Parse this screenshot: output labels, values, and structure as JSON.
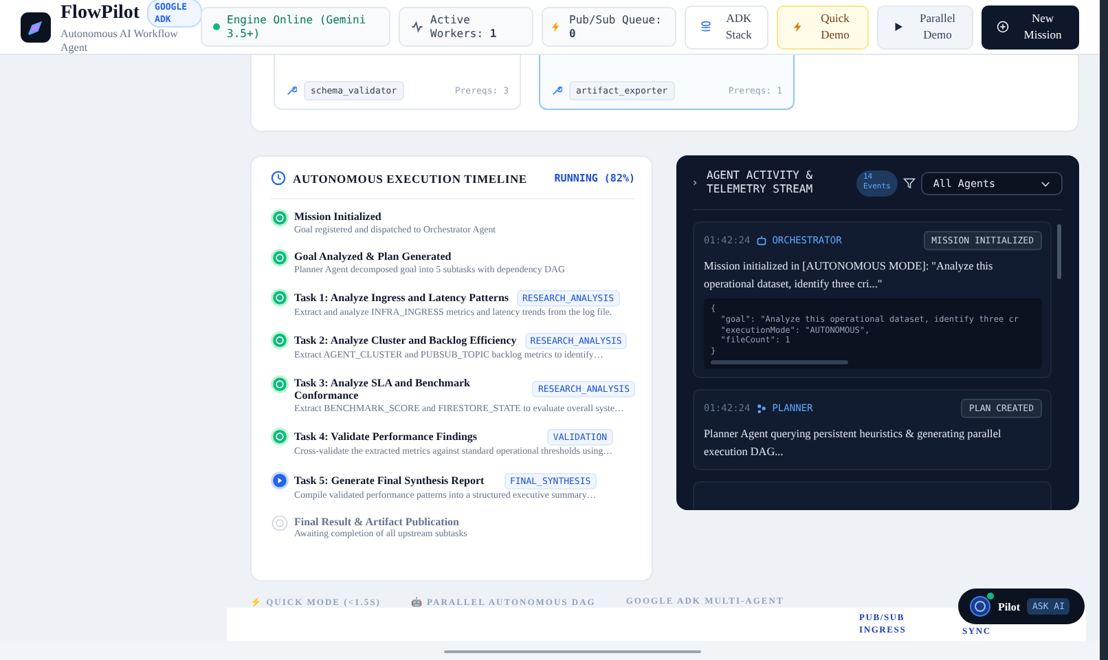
{
  "header": {
    "app_name": "FlowPilot",
    "badge": "GOOGLE ADK",
    "subtitle": "Autonomous AI Workflow Agent",
    "status_chips": [
      {
        "kind": "engine",
        "label": "Engine Online (Gemini 3.5+)"
      },
      {
        "kind": "workers",
        "label": "Active Workers:",
        "value": "1"
      },
      {
        "kind": "queue",
        "label": "Pub/Sub Queue:",
        "value": "0"
      }
    ],
    "buttons": [
      {
        "kind": "stack",
        "label": "ADK Stack"
      },
      {
        "kind": "quick",
        "label": "Quick Demo"
      },
      {
        "kind": "parallel",
        "label": "Parallel Demo"
      },
      {
        "kind": "new",
        "label": "New Mission"
      }
    ]
  },
  "tools": [
    {
      "name": "schema_validator",
      "prereqs": "Prereqs: 3",
      "selected": false
    },
    {
      "name": "artifact_exporter",
      "prereqs": "Prereqs: 1",
      "selected": true
    }
  ],
  "timeline": {
    "title": "AUTONOMOUS EXECUTION TIMELINE",
    "status": "RUNNING (82%)",
    "steps": [
      {
        "kind": "done",
        "title": "Mission Initialized",
        "desc": "Goal registered and dispatched to Orchestrator Agent"
      },
      {
        "kind": "done",
        "title": "Goal Analyzed & Plan Generated",
        "desc": "Planner Agent decomposed goal into 5 subtasks with dependency DAG"
      },
      {
        "kind": "done",
        "title": "Task 1: Analyze Ingress and Latency Patterns",
        "tag": "RESEARCH_ANALYSIS",
        "desc": "Extract and analyze INFRA_INGRESS metrics and latency trends from the log file."
      },
      {
        "kind": "done",
        "title": "Task 2: Analyze Cluster and Backlog Efficiency",
        "tag": "RESEARCH_ANALYSIS",
        "desc": "Extract AGENT_CLUSTER and PUBSUB_TOPIC backlog metrics to identify…"
      },
      {
        "kind": "done",
        "title": "Task 3: Analyze SLA and Benchmark Conformance",
        "tag": "RESEARCH_ANALYSIS",
        "desc": "Extract BENCHMARK_SCORE and FIRESTORE_STATE to evaluate overall syste…"
      },
      {
        "kind": "done",
        "title": "Task 4: Validate Performance Findings",
        "tag": "VALIDATION",
        "desc": "Cross-validate the extracted metrics against standard operational thresholds using…"
      },
      {
        "kind": "active",
        "title": "Task 5: Generate Final Synthesis Report",
        "tag": "FINAL_SYNTHESIS",
        "desc": "Compile validated performance patterns into a structured executive summary…"
      },
      {
        "kind": "pending",
        "title": "Final Result & Artifact Publication",
        "desc": "Awaiting completion of all upstream subtasks"
      }
    ]
  },
  "activity": {
    "title": "AGENT ACTIVITY & TELEMETRY STREAM",
    "count": "14",
    "count_label": "Events",
    "filter": "All Agents",
    "events": [
      {
        "time": "01:42:24",
        "agent": "ORCHESTRATOR",
        "kind": "orchestrator",
        "badge": "MISSION INITIALIZED",
        "message": "Mission initialized in [AUTONOMOUS MODE]: \"Analyze this operational dataset, identify three cri...\"",
        "code": [
          "{",
          "  \"goal\": \"Analyze this operational dataset, identify three cr",
          "  \"executionMode\": \"AUTONOMOUS\",",
          "  \"fileCount\": 1",
          "}"
        ]
      },
      {
        "time": "01:42:24",
        "agent": "PLANNER",
        "kind": "planner",
        "badge": "PLAN CREATED",
        "message": "Planner Agent querying persistent heuristics & generating parallel execution DAG..."
      }
    ]
  },
  "footer": {
    "features": [
      {
        "icon": "⚡",
        "label": "QUICK MODE (<1.5S)"
      },
      {
        "icon": "🤖",
        "label": "PARALLEL AUTONOMOUS DAG"
      },
      {
        "label": "GOOGLE ADK MULTI-AGENT"
      }
    ],
    "columns": [
      "PUB/SUB INGRESS",
      "SYNC"
    ]
  },
  "assistant": {
    "name": "Pilot",
    "action": "ASK AI",
    "online": true
  }
}
